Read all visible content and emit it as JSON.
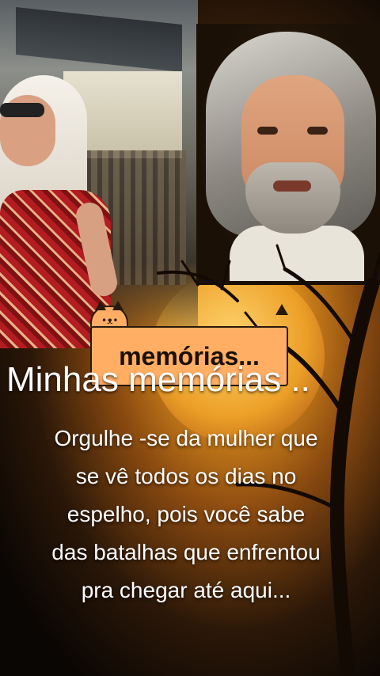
{
  "sticker": {
    "label": "memórias...",
    "icon": "cat-icon"
  },
  "title": "Minhas memórias ..",
  "caption": {
    "lines": [
      "Orgulhe -se da mulher que",
      "se vê  todos os dias no",
      "espelho, pois  você  sabe",
      "das batalhas que enfrentou",
      "pra chegar até  aqui..."
    ]
  },
  "colors": {
    "sticker_fill": "#ffae63",
    "text": "#ffffff",
    "sunset": "#f1a42a"
  }
}
